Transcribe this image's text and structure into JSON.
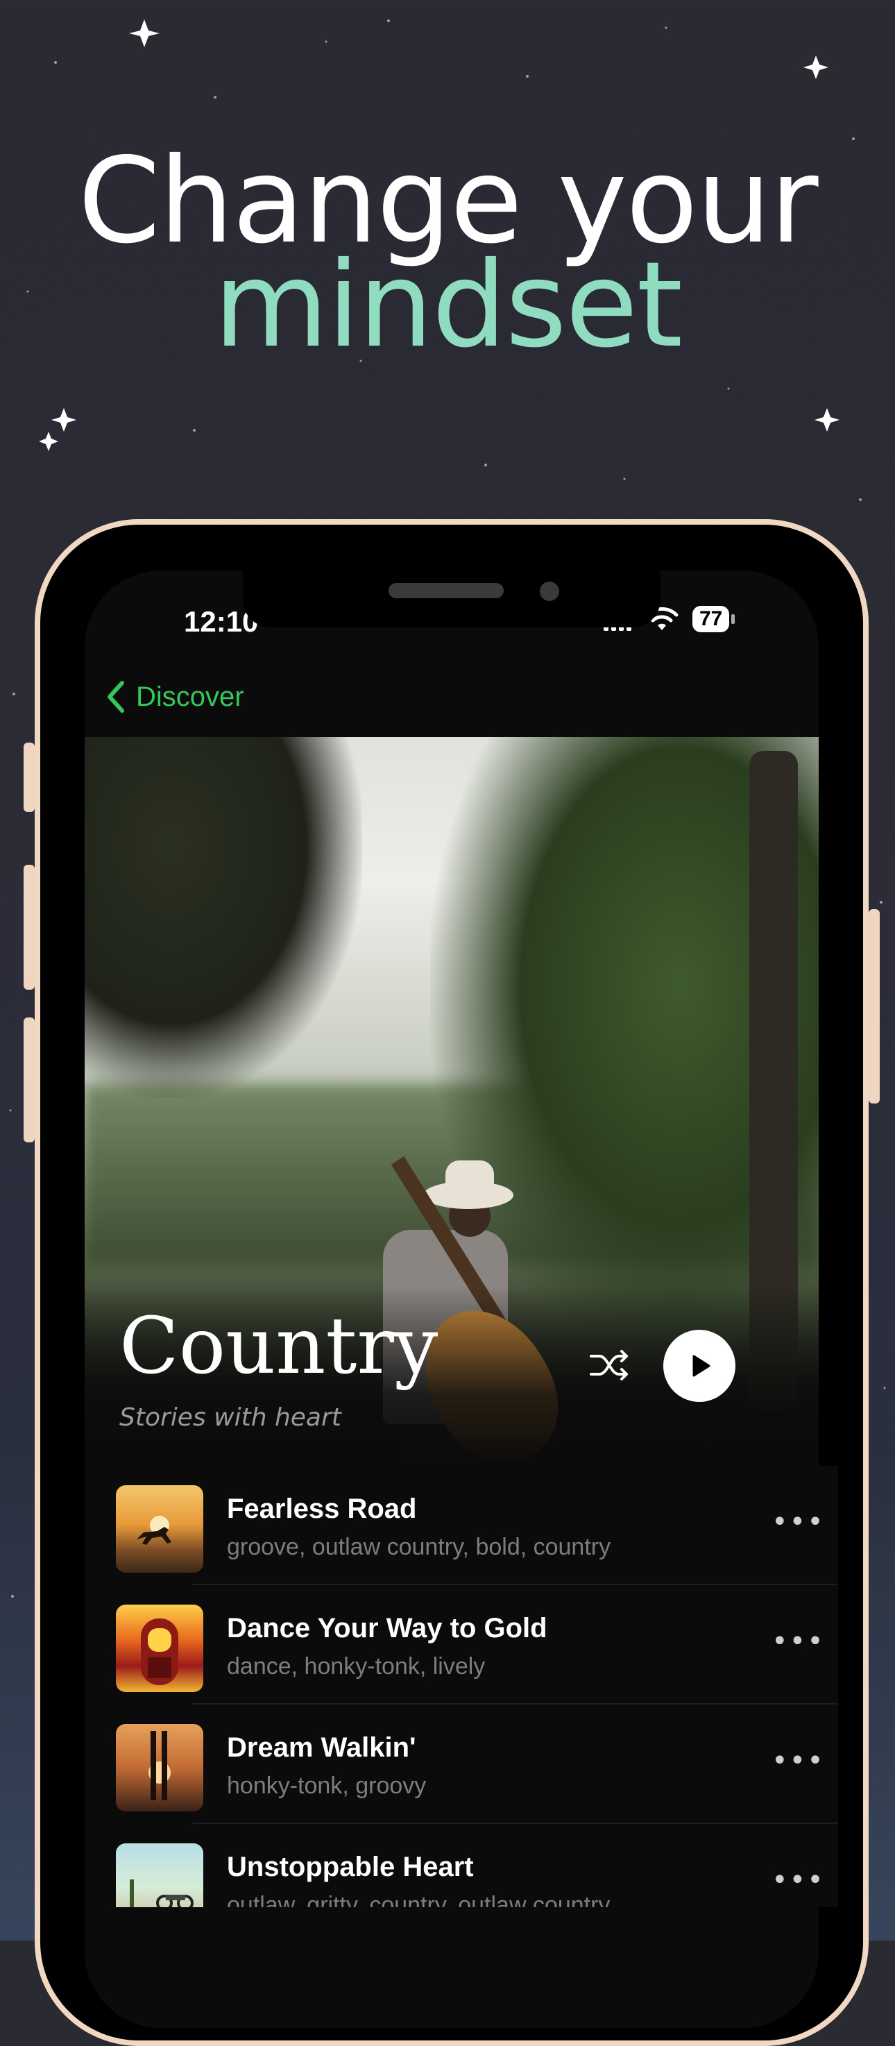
{
  "headline": {
    "line1": "Change your",
    "line2": "mindset"
  },
  "status_bar": {
    "time": "12:10",
    "battery": "77"
  },
  "nav": {
    "back_label": "Discover"
  },
  "genre": {
    "title": "Country",
    "subtitle": "Stories with heart"
  },
  "tracks": [
    {
      "title": "Fearless Road",
      "tags": "groove, outlaw country, bold, country"
    },
    {
      "title": "Dance Your Way to Gold",
      "tags": "dance, honky-tonk, lively"
    },
    {
      "title": "Dream Walkin'",
      "tags": "honky-tonk, groovy"
    },
    {
      "title": "Unstoppable Heart",
      "tags": "outlaw, gritty, country, outlaw country"
    }
  ],
  "icons": {
    "back": "chevron-left-icon",
    "shuffle": "shuffle-icon",
    "play": "play-icon",
    "more": "more-icon",
    "wifi": "wifi-icon",
    "signal": "signal-icon"
  },
  "colors": {
    "accent": "#34c759",
    "headline_accent": "#8fdcc0",
    "background": "#2a2a33"
  }
}
